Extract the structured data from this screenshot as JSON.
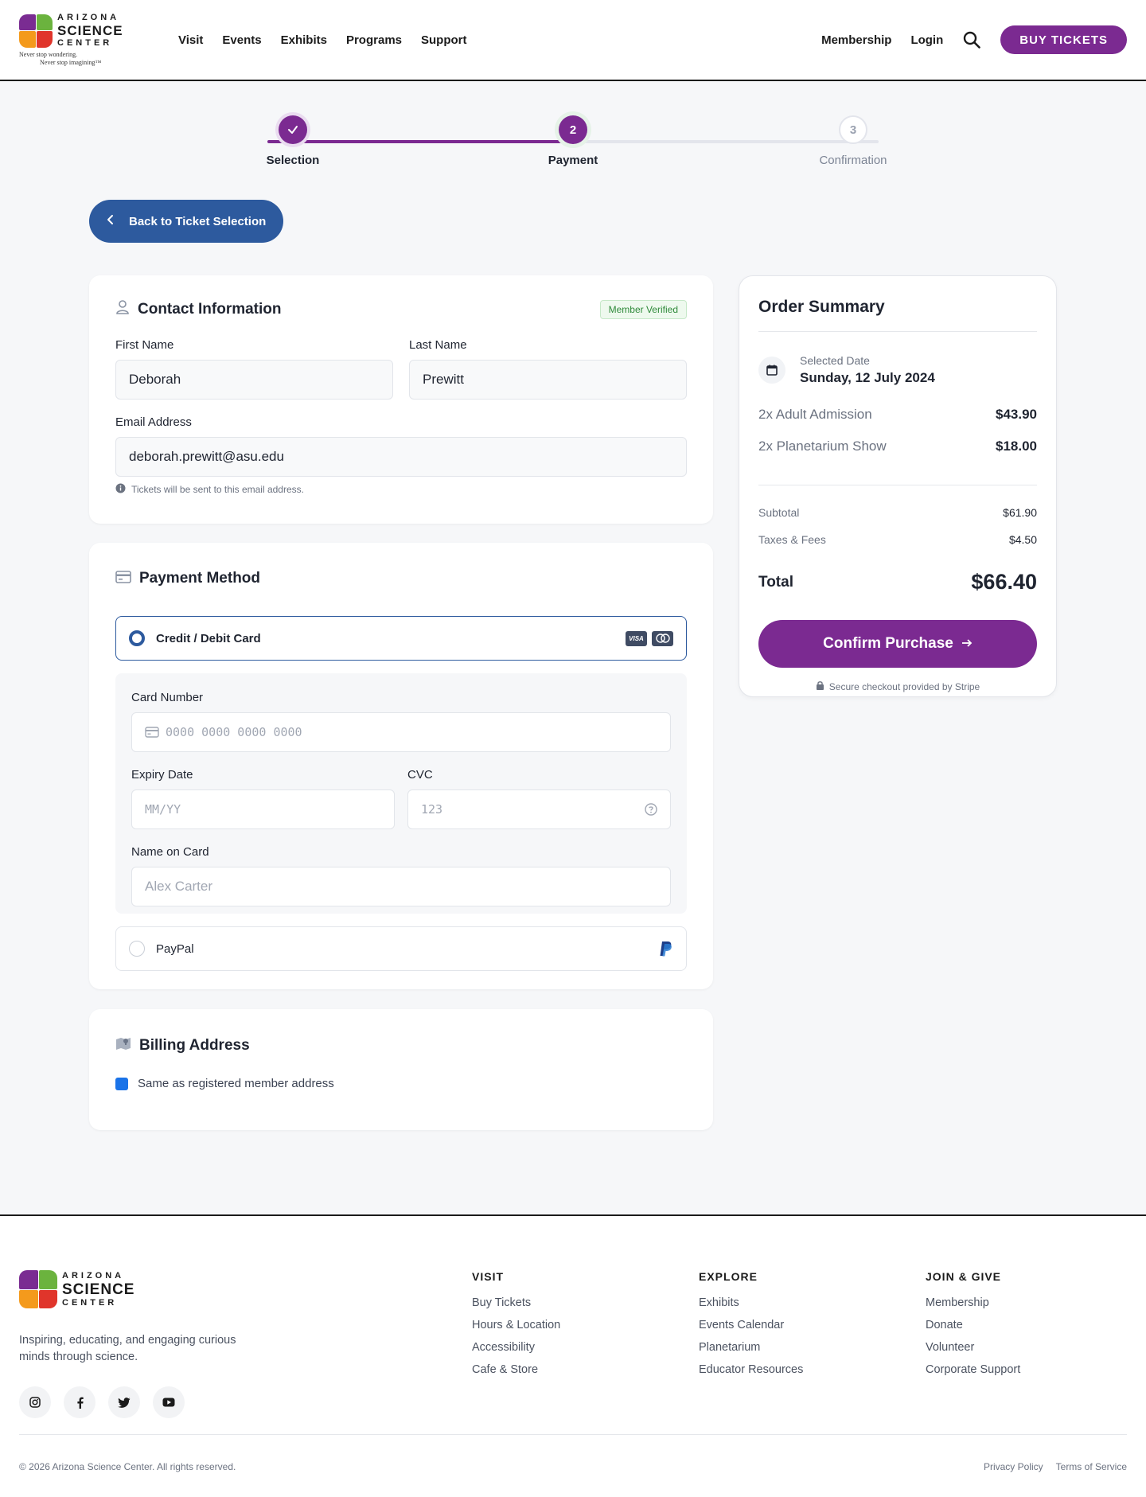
{
  "brand": {
    "line1": "ARIZONA",
    "line2": "SCIENCE",
    "line3": "CENTER",
    "tagline1": "Never stop wondering.",
    "tagline2": "Never stop imagining™"
  },
  "nav": {
    "items": [
      "Visit",
      "Events",
      "Exhibits",
      "Programs",
      "Support"
    ],
    "membership": "Membership",
    "login": "Login",
    "buy_tickets": "BUY TICKETS"
  },
  "stepper": {
    "steps": [
      {
        "number": "✓",
        "label": "Selection",
        "state": "done"
      },
      {
        "number": "2",
        "label": "Payment",
        "state": "active"
      },
      {
        "number": "3",
        "label": "Confirmation",
        "state": "todo"
      }
    ],
    "progress": 0.5
  },
  "back_button": "Back to Ticket Selection",
  "contact": {
    "title": "Contact Information",
    "badge": "Member Verified",
    "first_name_label": "First Name",
    "first_name": "Deborah",
    "last_name_label": "Last Name",
    "last_name": "Prewitt",
    "email_label": "Email Address",
    "email": "deborah.prewitt@asu.edu",
    "hint": "Tickets will be sent to this email address."
  },
  "payment": {
    "title": "Payment Method",
    "card_option": "Credit / Debit Card",
    "card_number_label": "Card Number",
    "card_number_placeholder": "0000 0000 0000 0000",
    "expiry_label": "Expiry Date",
    "expiry_placeholder": "MM/YY",
    "cvc_label": "CVC",
    "cvc_placeholder": "123",
    "name_label": "Name on Card",
    "name_placeholder": "Alex Carter",
    "paypal_option": "PayPal",
    "visa": "VISA"
  },
  "billing": {
    "title": "Billing Address",
    "same_as_member": "Same as registered member address"
  },
  "summary": {
    "title": "Order Summary",
    "date_label": "Selected Date",
    "date_value": "Sunday, 12 July 2024",
    "items": [
      {
        "name": "2x Adult Admission",
        "price": "$43.90"
      },
      {
        "name": "2x Planetarium Show",
        "price": "$18.00"
      }
    ],
    "subtotal_label": "Subtotal",
    "subtotal": "$61.90",
    "fees_label": "Taxes & Fees",
    "fees": "$4.50",
    "total_label": "Total",
    "total": "$66.40",
    "confirm": "Confirm Purchase",
    "secure": "Secure checkout provided by Stripe"
  },
  "footer": {
    "description": "Inspiring, educating, and engaging curious minds through science.",
    "socials": [
      "instagram-icon",
      "facebook-icon",
      "twitter-icon",
      "youtube-icon"
    ],
    "columns": [
      {
        "title": "VISIT",
        "links": [
          "Buy Tickets",
          "Hours & Location",
          "Accessibility",
          "Cafe & Store"
        ]
      },
      {
        "title": "EXPLORE",
        "links": [
          "Exhibits",
          "Events Calendar",
          "Planetarium",
          "Educator Resources"
        ]
      },
      {
        "title": "JOIN & GIVE",
        "links": [
          "Membership",
          "Donate",
          "Volunteer",
          "Corporate Support"
        ]
      }
    ],
    "copyright": "© 2026 Arizona Science Center. All rights reserved.",
    "privacy": "Privacy Policy",
    "terms": "Terms of Service"
  },
  "colors": {
    "brand_purple": "#7b2a91",
    "action_blue": "#2d5a9e",
    "checkbox_blue": "#1a73e8",
    "verified_green": "#2f8a3a"
  }
}
